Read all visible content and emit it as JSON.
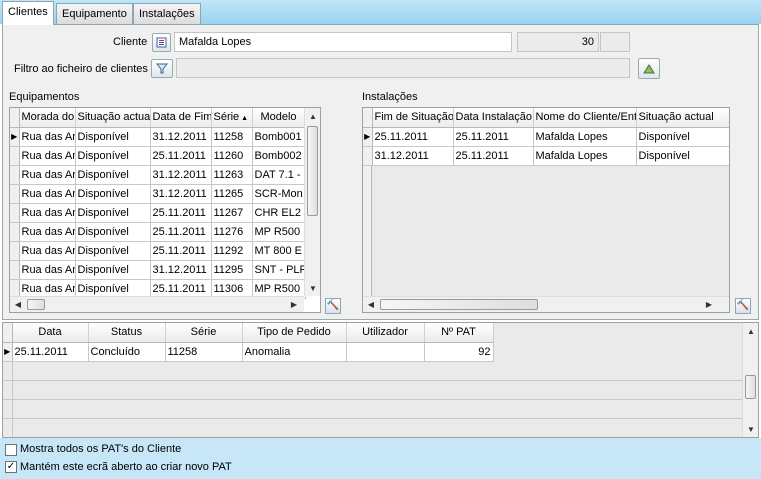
{
  "tabs": [
    {
      "label": "Clientes"
    },
    {
      "label": "Equipamento"
    },
    {
      "label": "Instalações"
    }
  ],
  "client": {
    "label": "Cliente",
    "name": "Mafalda Lopes",
    "number": "30",
    "filter_label": "Filtro ao ficheiro de clientes",
    "filter_value": ""
  },
  "equipment": {
    "title": "Equipamentos",
    "columns": [
      "Morada do",
      "Situação actual",
      "Data de Fim",
      "Série",
      "Modelo"
    ],
    "rows": [
      [
        "Rua das Ar",
        "Disponível",
        "31.12.2011",
        "11258",
        "Bomb001"
      ],
      [
        "Rua das Ar",
        "Disponível",
        "25.11.2011",
        "11260",
        "Bomb002"
      ],
      [
        "Rua das Ar",
        "Disponível",
        "31.12.2011",
        "11263",
        "DAT 7.1 -"
      ],
      [
        "Rua das Ar",
        "Disponível",
        "31.12.2011",
        "11265",
        "SCR-Mon"
      ],
      [
        "Rua das Ar",
        "Disponível",
        "25.11.2011",
        "11267",
        "CHR EL2"
      ],
      [
        "Rua das Ar",
        "Disponível",
        "25.11.2011",
        "11276",
        "MP R500"
      ],
      [
        "Rua das Ar",
        "Disponível",
        "25.11.2011",
        "11292",
        "MT 800 E"
      ],
      [
        "Rua das Ar",
        "Disponível",
        "31.12.2011",
        "11295",
        "SNT - PLF"
      ],
      [
        "Rua das Ar",
        "Disponível",
        "25.11.2011",
        "11306",
        "MP R500"
      ]
    ]
  },
  "installations": {
    "title": "Instalações",
    "columns": [
      "Fim de Situação",
      "Data Instalação",
      "Nome do Cliente/Entid",
      "Situação actual"
    ],
    "rows": [
      [
        "25.11.2011",
        "25.11.2011",
        "Mafalda Lopes",
        "Disponível"
      ],
      [
        "31.12.2011",
        "25.11.2011",
        "Mafalda Lopes",
        "Disponível"
      ]
    ]
  },
  "pats": {
    "columns": [
      "Data",
      "Status",
      "Série",
      "Tipo de Pedido",
      "Utilizador",
      "Nº PAT"
    ],
    "rows": [
      [
        "25.11.2011",
        "Concluído",
        "11258",
        "Anomalia",
        "",
        "92"
      ]
    ]
  },
  "options": {
    "show_all_label": "Mostra todos os PAT's do Cliente",
    "show_all_checked": false,
    "keep_open_label": "Mantém este ecrã aberto ao criar novo PAT",
    "keep_open_checked": true
  }
}
